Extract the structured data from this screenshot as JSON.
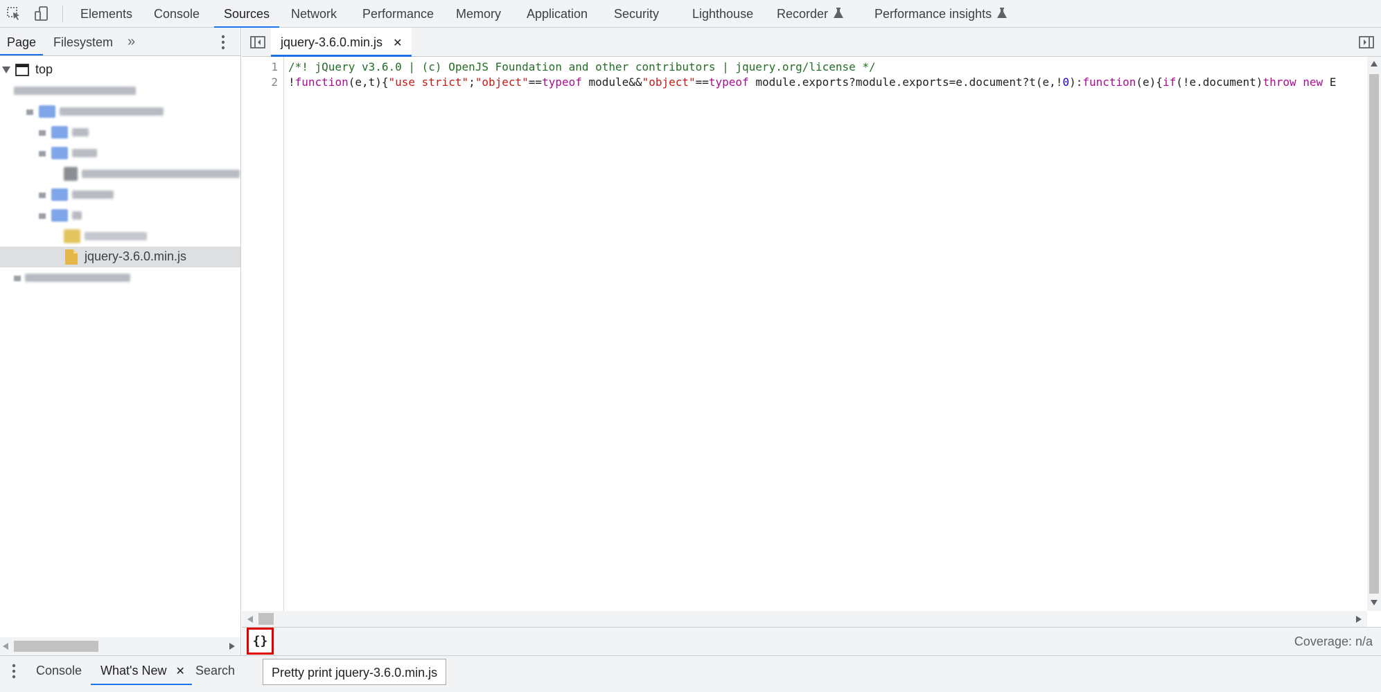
{
  "toolbar": {
    "tabs": [
      {
        "label": "Elements"
      },
      {
        "label": "Console"
      },
      {
        "label": "Sources"
      },
      {
        "label": "Network"
      },
      {
        "label": "Performance"
      },
      {
        "label": "Memory"
      },
      {
        "label": "Application"
      },
      {
        "label": "Security"
      },
      {
        "label": "Lighthouse"
      },
      {
        "label": "Recorder"
      },
      {
        "label": "Performance insights"
      }
    ],
    "active_tab": "Sources",
    "icons": [
      "inspect-element-icon",
      "device-toolbar-icon",
      "flask-icon"
    ]
  },
  "navigator": {
    "tabs": [
      {
        "label": "Page"
      },
      {
        "label": "Filesystem"
      }
    ],
    "active_tab": "Page",
    "tree": {
      "root_label": "top",
      "selected_file": "jquery-3.6.0.min.js"
    }
  },
  "editor": {
    "open_file": "jquery-3.6.0.min.js",
    "line_numbers": [
      "1",
      "2"
    ],
    "lines": [
      "/*! jQuery v3.6.0 | (c) OpenJS Foundation and other contributors | jquery.org/license */",
      "!function(e,t){\"use strict\";\"object\"==typeof module&&\"object\"==typeof module.exports?module.exports=e.document?t(e,!0):function(e){if(!e.document)throw new E"
    ]
  },
  "status": {
    "pretty_print_label": "{}",
    "coverage": "Coverage: n/a"
  },
  "drawer": {
    "tabs": [
      {
        "label": "Console"
      },
      {
        "label": "What's New"
      },
      {
        "label": "Search"
      }
    ],
    "active_tab": "What's New",
    "tooltip": "Pretty print jquery-3.6.0.min.js"
  },
  "colors": {
    "accent": "#1a73e8",
    "highlight_box": "#e00000",
    "comment": "#236e25",
    "keyword": "#aa0d91",
    "string": "#c41a16"
  }
}
